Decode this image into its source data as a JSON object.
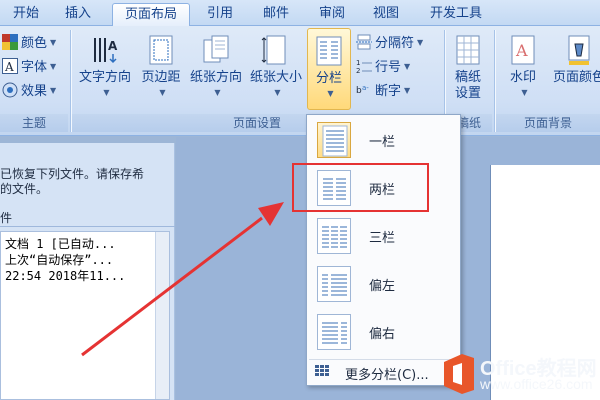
{
  "tabs": [
    "开始",
    "插入",
    "页面布局",
    "引用",
    "邮件",
    "审阅",
    "视图",
    "开发工具"
  ],
  "active_tab": "页面布局",
  "ribbon": {
    "theme_group": {
      "colors_label": "颜色",
      "fonts_label": "字体",
      "effects_label": "效果",
      "group_label": "主题"
    },
    "page_setup_group": {
      "text_direction_label": "文字方向",
      "margins_label": "页边距",
      "orientation_label": "纸张方向",
      "size_label": "纸张大小",
      "columns_label": "分栏",
      "breaks_label": "分隔符",
      "line_numbers_label": "行号",
      "hyphenation_label": "断字",
      "group_label": "页面设置"
    },
    "manuscript_group": {
      "manuscript_line1": "稿纸",
      "manuscript_line2": "设置",
      "group_label": "稿纸"
    },
    "background_group": {
      "watermark_label": "水印",
      "page_color_label": "页面颜色",
      "group_label": "页面背景"
    }
  },
  "recovery_panel": {
    "message_line1": "已恢复下列文件。请保存希",
    "message_line2": "的文件。",
    "header": "件",
    "file_name": "文档 1  [已自动...",
    "file_line2": "上次“自动保存”...",
    "file_line3": "22:54 2018年11..."
  },
  "columns_menu": {
    "items": [
      {
        "label": "一栏"
      },
      {
        "label": "两栏"
      },
      {
        "label": "三栏"
      },
      {
        "label": "偏左"
      },
      {
        "label": "偏右"
      }
    ],
    "more_label": "更多分栏(C)..."
  },
  "watermark": {
    "brand": "Office教程网",
    "url": "www.office26.com"
  },
  "colors": {
    "highlight_box": "#e53333",
    "arrow": "#e53333",
    "accent": "#15428b"
  }
}
